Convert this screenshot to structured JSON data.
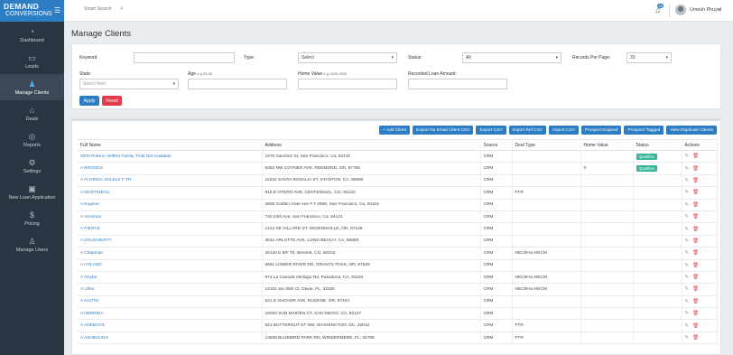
{
  "brand": {
    "line1": "DEMAND",
    "line2": "CONVERSIONS",
    "menu_icon": "hamburger-icon"
  },
  "sidebar": {
    "items": [
      {
        "label": "Dashboard",
        "icon": "gauge-icon",
        "glyph": "◔",
        "active": false
      },
      {
        "label": "Leads",
        "icon": "folder-icon",
        "glyph": "▭",
        "active": false
      },
      {
        "label": "Manage Clients",
        "icon": "person-icon",
        "glyph": "♟",
        "active": true
      },
      {
        "label": "Deals",
        "icon": "bank-icon",
        "glyph": "⌂",
        "active": false
      },
      {
        "label": "Reports",
        "icon": "chart-icon",
        "glyph": "◎",
        "active": false
      },
      {
        "label": "Settings",
        "icon": "gear-icon",
        "glyph": "⚙",
        "active": false
      },
      {
        "label": "New Loan Application",
        "icon": "briefcase-icon",
        "glyph": "▣",
        "active": false
      },
      {
        "label": "Pricing",
        "icon": "dollar-icon",
        "glyph": "$",
        "active": false
      },
      {
        "label": "Manage Users",
        "icon": "users-icon",
        "glyph": "♙",
        "active": false
      }
    ]
  },
  "topbar": {
    "search_placeholder": "Smart Search",
    "notification_count": "56",
    "user_name": "Umesh Phuyal"
  },
  "page": {
    "title": "Manage Clients"
  },
  "filters": {
    "keyword_label": "Keyword",
    "keyword_value": "",
    "type_label": "Type:",
    "type_value": "Select",
    "status_label": "Status:",
    "status_value": "All",
    "records_label": "Records Per Page:",
    "records_value": "20",
    "state_label": "State:",
    "state_placeholder": "Select Item",
    "age_label": "Age",
    "age_hint": "e.g 45-50",
    "home_value_label": "Home Value",
    "home_value_hint": "e.g 1000-2000",
    "loan_label": "Recorded Loan Amount:",
    "apply_label": "Apply",
    "reset_label": "Reset"
  },
  "toolbar": {
    "buttons": [
      "+ Add Client",
      "Export No Email Client CSV",
      "Export CSV",
      "Import Ref CSV",
      "Import CSV",
      "Prospect Expired",
      "Prospect Tagged",
      "View Duplicate Clients"
    ]
  },
  "table": {
    "headers": [
      "Full Name",
      "Address",
      "Source",
      "Deal Type",
      "Home Value",
      "Status",
      "Actions"
    ],
    "rows": [
      {
        "name": "2000 Pulvino Veltfort Family Trust Not Available",
        "address": "1670 Sanchez St, San Francisco, Ca, 94131",
        "source": "CRM",
        "deal": "",
        "home": "",
        "status": "Qualifies"
      },
      {
        "name": "A BROOKS",
        "address": "5353 NW COYNER AVE, REDMOND, OR, 97756",
        "source": "CRM",
        "deal": "",
        "home": "0",
        "status": "Qualifies"
      },
      {
        "name": "A FLORIDA AOLELE F TR",
        "address": "11532 SANTA ROSALIA ST, STANTON, CA, 90680",
        "source": "CRM",
        "deal": "",
        "home": "",
        "status": ""
      },
      {
        "name": "A MARTINEAU",
        "address": "916 E OTERO AVE, CENTENNIAL, CO, 80122",
        "source": "CRM",
        "deal": "FTR",
        "home": "",
        "status": ""
      },
      {
        "name": "A Eugene",
        "address": "2806 Golden Gate Ave # # 2608, San Francisco, Ca, 94118",
        "source": "CRM",
        "deal": "",
        "home": "",
        "status": ""
      },
      {
        "name": "A Veronica",
        "address": "740 24th Ave, San Francisco, Ca, 94121",
        "source": "CRM",
        "deal": "",
        "home": "",
        "status": ""
      },
      {
        "name": "A PIERCE",
        "address": "1414 SE VILLARD ST, MCMINNVILLE, OR, 97128",
        "source": "CRM",
        "deal": "",
        "home": "",
        "status": ""
      },
      {
        "name": "A DOUGHERTY",
        "address": "3041 ARLOTTE AVE, LONG BEACH, CA, 90808",
        "source": "CRM",
        "deal": "",
        "home": "",
        "status": ""
      },
      {
        "name": "A Chapman",
        "address": "45130 E 8/F Trl, Bennett, CO, 80102",
        "source": "CRM",
        "deal": "HECM-to-HECM",
        "home": "",
        "status": ""
      },
      {
        "name": "A HYLAND",
        "address": "6661 LOWER RIVER RD, GRANTS PASS, OR, 97526",
        "source": "CRM",
        "deal": "",
        "home": "",
        "status": ""
      },
      {
        "name": "A Ghylar",
        "address": "974 La Canada Verdugo Rd, Pasadena, CA, 91103",
        "source": "CRM",
        "deal": "HECM-to-HECM",
        "home": "",
        "status": ""
      },
      {
        "name": "A Ullno",
        "address": "14101 Sw 36th Ct, Davie, FL, 33330",
        "source": "CRM",
        "deal": "HECM-to-HECM",
        "home": "",
        "status": ""
      },
      {
        "name": "A KLOTH",
        "address": "531 E ANCHOR AVE, EUGENE, OR, 97404",
        "source": "CRM",
        "deal": "",
        "home": "",
        "status": ""
      },
      {
        "name": "A NEBRIDA",
        "address": "18253 SUN MAIDEN CT, SAN DIEGO, CA, 92127",
        "source": "CRM",
        "deal": "",
        "home": "",
        "status": ""
      },
      {
        "name": "A ADEBOYE",
        "address": "521 BUTTERNUT ST NW, WASHINGTON, DC, 20012",
        "source": "CRM",
        "deal": "FTR",
        "home": "",
        "status": ""
      },
      {
        "name": "A ASHBAUGH",
        "address": "13838 BLUEBIRD PARK RD, WINDERMERE, FL, 34786",
        "source": "CRM",
        "deal": "FTR",
        "home": "",
        "status": ""
      }
    ]
  },
  "colors": {
    "sidebar": "#2b3542",
    "brand": "#2c7dc3",
    "primary": "#2c7dc3",
    "danger": "#e33a4c",
    "qualifies": "#31b596"
  }
}
